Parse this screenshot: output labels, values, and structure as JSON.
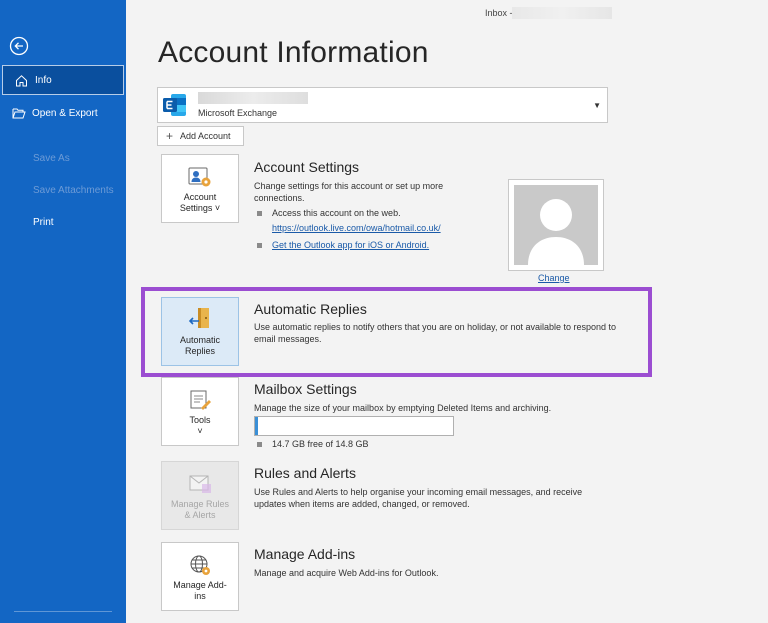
{
  "sidebar": {
    "items": [
      {
        "label": "Info",
        "icon": "home-icon",
        "active": true
      },
      {
        "label": "Open & Export",
        "icon": "folder-open-icon"
      },
      {
        "label": "Save As",
        "disabled": true
      },
      {
        "label": "Save Attachments",
        "disabled": true
      },
      {
        "label": "Print"
      }
    ]
  },
  "window": {
    "inbox_label": "Inbox -"
  },
  "page": {
    "title": "Account Information"
  },
  "account": {
    "type": "Microsoft Exchange",
    "add_label": "Add Account"
  },
  "account_settings": {
    "tile_label_1": "Account",
    "tile_label_2": "Settings ˅",
    "title": "Account Settings",
    "desc": "Change settings for this account or set up more connections.",
    "bullet_1": "Access this account on the web.",
    "link_1": "https://outlook.live.com/owa/hotmail.co.uk/",
    "link_2": "Get the Outlook app for iOS or Android.",
    "change_label": "Change"
  },
  "automatic_replies": {
    "tile_label_1": "Automatic",
    "tile_label_2": "Replies",
    "title": "Automatic Replies",
    "desc": "Use automatic replies to notify others that you are on holiday, or not available to respond to email messages."
  },
  "mailbox_settings": {
    "tile_label_1": "Tools",
    "tile_label_2": "˅",
    "title": "Mailbox Settings",
    "desc": "Manage the size of your mailbox by emptying Deleted Items and archiving.",
    "usage_fraction": 0.007,
    "usage_label": "14.7 GB free of 14.8 GB"
  },
  "rules_alerts": {
    "tile_label_1": "Manage Rules",
    "tile_label_2": "& Alerts",
    "title": "Rules and Alerts",
    "desc": "Use Rules and Alerts to help organise your incoming email messages, and receive updates when items are added, changed, or removed."
  },
  "addins": {
    "tile_label_1": "Manage Add-",
    "tile_label_2": "ins",
    "title": "Manage Add-ins",
    "desc": "Manage and acquire Web Add-ins for Outlook."
  },
  "colors": {
    "sidebar": "#1366c4",
    "highlight": "#9b4dd1",
    "link": "#1a5aa8"
  }
}
